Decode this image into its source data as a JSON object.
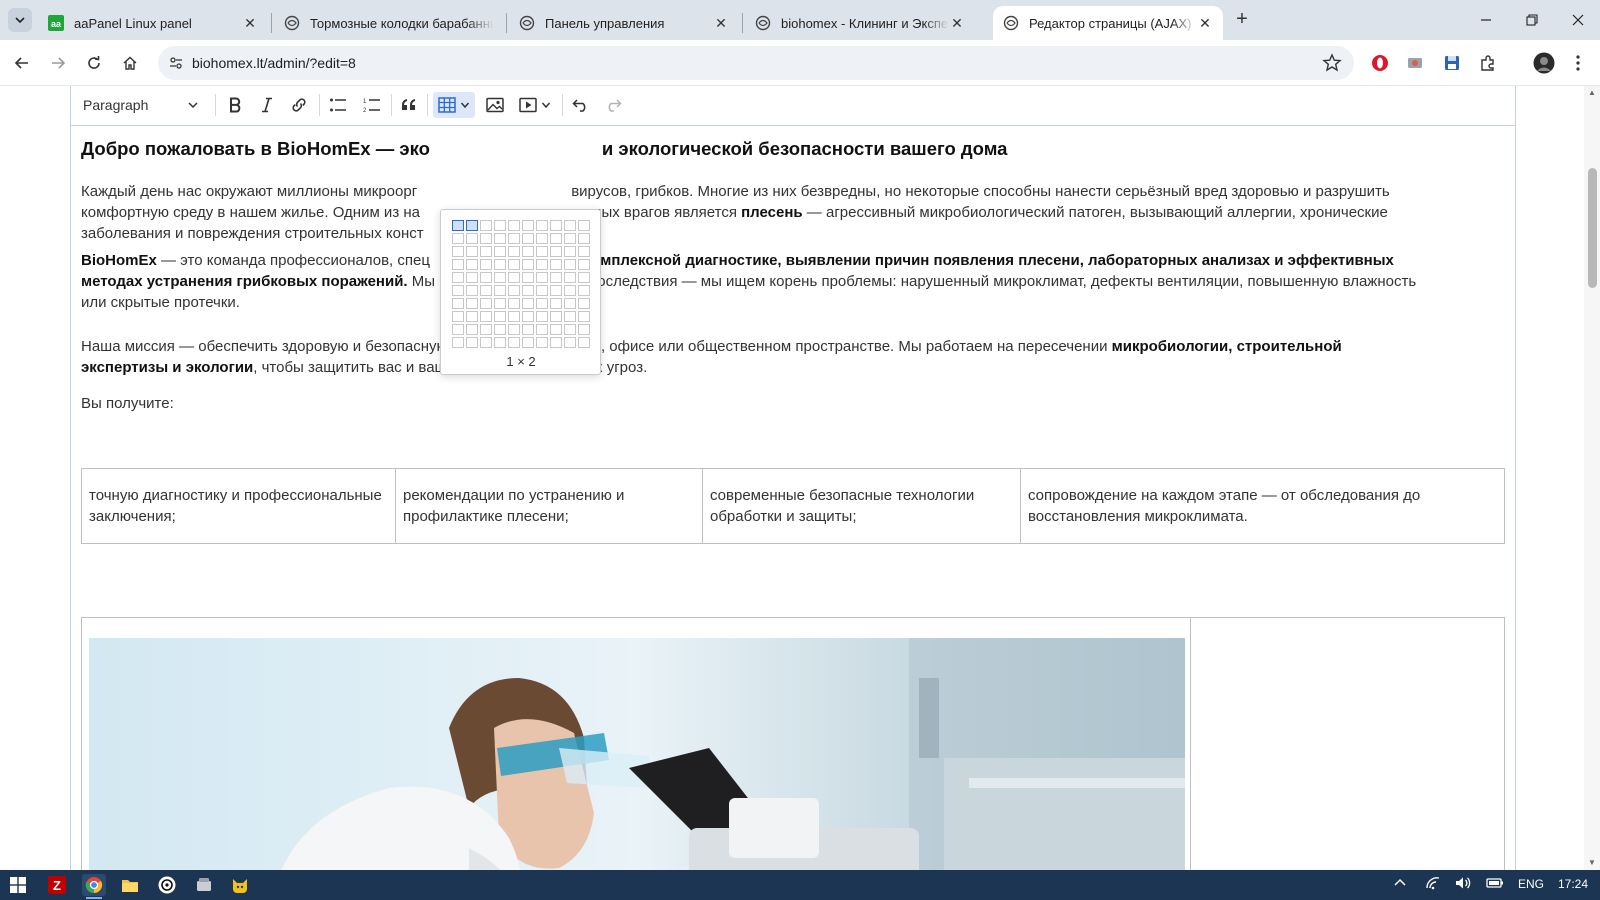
{
  "browser": {
    "tabs": [
      {
        "title": "aaPanel Linux panel",
        "icon": "aapanel-icon",
        "active": false
      },
      {
        "title": "Тормозные колодки барабанные",
        "icon": "globe-icon",
        "active": false
      },
      {
        "title": "Панель управления",
        "icon": "globe-icon",
        "active": false
      },
      {
        "title": "biohomex - Клининг и Экспертиза",
        "icon": "globe-icon",
        "active": false
      },
      {
        "title": "Редактор страницы (AJAX)",
        "icon": "globe-icon",
        "active": true
      }
    ],
    "close_glyph": "✕",
    "new_tab_glyph": "+",
    "url": "biohomex.lt/admin/?edit=8"
  },
  "editor": {
    "block_format": "Paragraph",
    "table_picker": {
      "rows": 10,
      "cols": 10,
      "selected_rows": 1,
      "selected_cols": 2,
      "label": "1 × 2"
    },
    "heading_pre": "Добро пожаловать в BioHomEx — эко",
    "heading_post": "и экологической безопасности вашего дома",
    "p1": {
      "line1_pre": "Каждый день нас окружают миллионы микроорг",
      "line1_post": "вирусов, грибков. Многие из них безвредны, но некоторые способны нанести серьёзный вред здоровью и разрушить",
      "line2_pre": "комфортную среду в нашем жилье. Одним из на",
      "line2_mid": "димых врагов является ",
      "line2_bold": "плесень",
      "line2_post": " — агрессивный микробиологический патоген, вызывающий аллергии, хронические",
      "line3": "заболевания и повреждения строительных конст"
    },
    "p2": {
      "bold1": "BioHomEx",
      "line1_pre": " — это команда профессионалов, спец",
      "line1_bold": "комплексной диагностике, выявлении причин появления плесени, лабораторных анализах и эффективных",
      "line2_bold": "методах устранения грибковых поражений.",
      "line2_post": " Мы не просто устраняем последствия — мы ищем корень проблемы: нарушенный микроклимат, дефекты вентиляции, повышенную влажность",
      "line3": "или скрытые протечки."
    },
    "p3": {
      "line1_pre": "Наша миссия — обеспечить здоровую и безопасную среду в каждом доме, офисе или общественном пространстве. Мы работаем на пересечении ",
      "line1_bold": "микробиологии, строительной",
      "line2_bold": "экспертизы и экологии",
      "line2_post": ", чтобы защитить вас и ваших близких от скрытых угроз."
    },
    "p4": "Вы получите:",
    "benefits": [
      "точную диагностику и профессиональные заключения;",
      "рекомендации по устранению и профилактике плесени;",
      "современные безопасные технологии обработки и защиты;",
      "сопровождение на каждом этапе — от обследования до восстановления микроклимата."
    ]
  },
  "taskbar": {
    "language": "ENG",
    "time": "17:24"
  },
  "colors": {
    "accent": "#2d6ad1",
    "taskbar": "#1b3552",
    "tabstrip": "#dde3ea"
  }
}
